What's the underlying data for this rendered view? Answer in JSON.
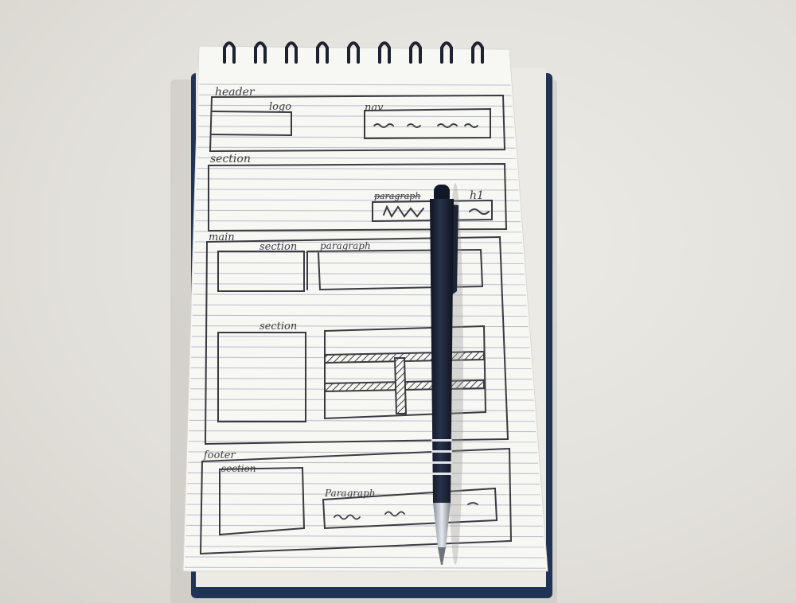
{
  "photo": {
    "subject": "Hand-drawn web page wireframe sketch on a spiral notepad with a pen",
    "colors": {
      "table": "#e6e4de",
      "paper": "#f7f7f4",
      "ruled_line": "#b9bdc6",
      "ink": "#3a3a40",
      "cover": "#1f3355",
      "pen_body": "#1b2230",
      "pen_band": "#dfe3ea"
    }
  },
  "sketch": {
    "header": {
      "label": "header",
      "logo_label": "logo",
      "nav_label": "nav"
    },
    "hero": {
      "label": "section",
      "paragraph_label": "paragraph",
      "h1_label": "h1"
    },
    "main": {
      "label": "main",
      "section_label": "section",
      "paragraph_label": "paragraph",
      "section2_label": "section"
    },
    "footer": {
      "label": "footer",
      "section_label": "section",
      "paragraph_label": "Paragraph"
    }
  },
  "icons": {
    "pen": "pen-icon",
    "spiral": "spiral-binding-icon"
  }
}
